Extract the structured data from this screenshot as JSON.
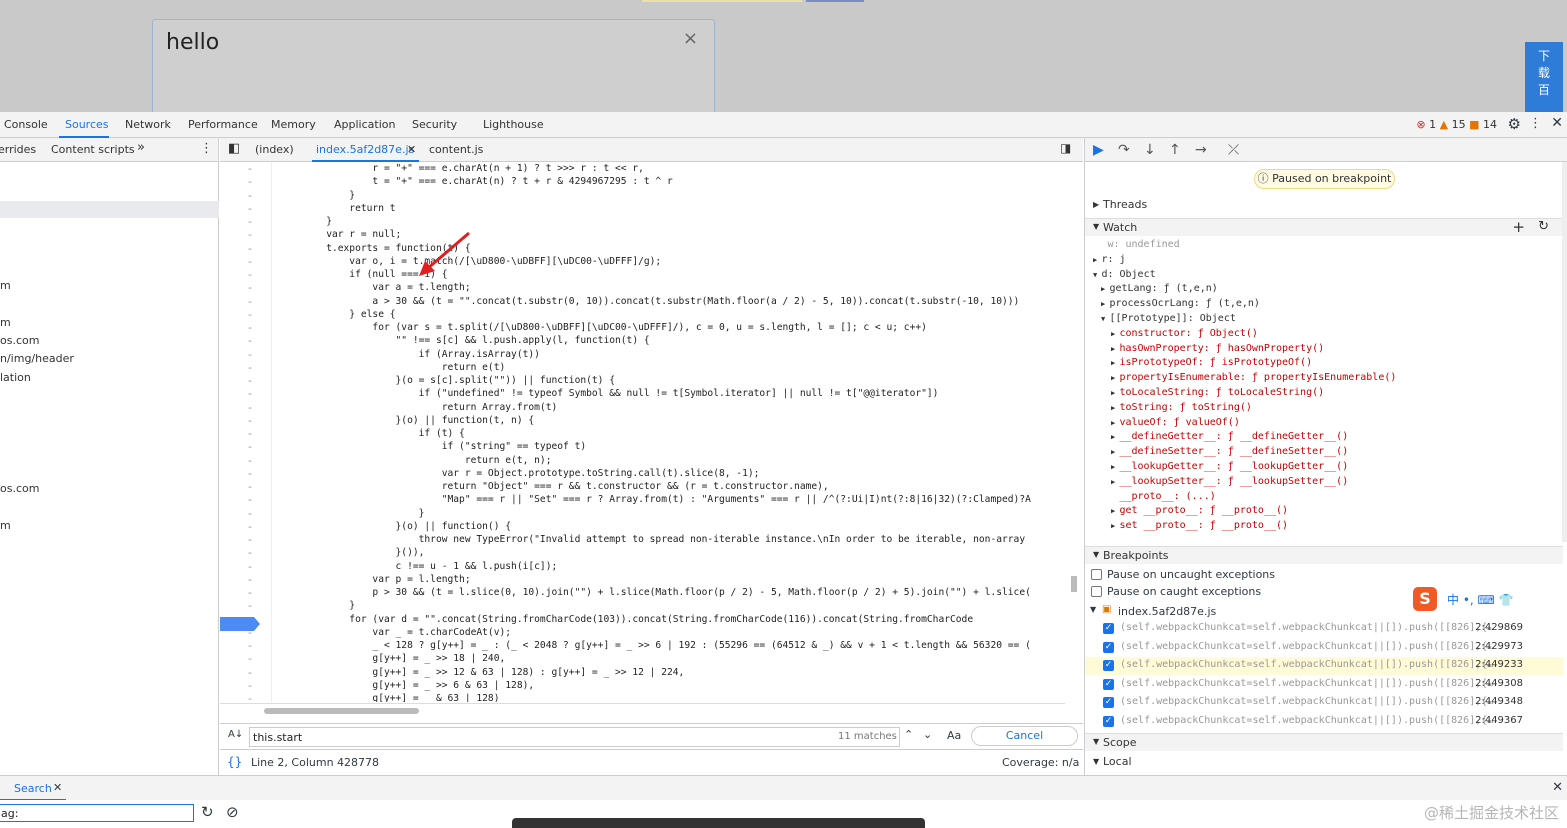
{
  "page": {
    "hello": "hello",
    "close_glyph": "×",
    "side_button": "下\n载\n百"
  },
  "devtools": {
    "tabs": [
      "Console",
      "Sources",
      "Network",
      "Performance",
      "Memory",
      "Application",
      "Security",
      "Lighthouse"
    ],
    "status": {
      "errors": "1",
      "warnings": "15",
      "issues": "14"
    }
  },
  "left": {
    "tabs": [
      "errides",
      "Content scripts"
    ],
    "more": "»",
    "tree": [
      "m",
      "m",
      "os.com",
      "n/img/header",
      "lation",
      "os.com",
      "m"
    ]
  },
  "editor": {
    "tabs": [
      "(index)",
      "index.5af2d87e.js",
      "content.js"
    ],
    "search_value": "this.start",
    "matches": "11 matches",
    "cancel": "Cancel",
    "match_case": "Aa",
    "regex": ".*",
    "position": "Line 2, Column 428778",
    "coverage": "Coverage: n/a",
    "lines": [
      "                r = \"+\" === e.charAt(n + 1) ? t >>> r : t << r,",
      "                t = \"+\" === e.charAt(n) ? t + r & 4294967295 : t ^ r",
      "            }",
      "            return t",
      "        }",
      "        var r = null;",
      "        t.exports = function(t) {",
      "            var o, i = t.match(/[\\uD800-\\uDBFF][\\uDC00-\\uDFFF]/g);",
      "            if (null === i) {",
      "                var a = t.length;",
      "                a > 30 && (t = \"\".concat(t.substr(0, 10)).concat(t.substr(Math.floor(a / 2) - 5, 10)).concat(t.substr(-10, 10)))",
      "            } else {",
      "                for (var s = t.split(/[\\uD800-\\uDBFF][\\uDC00-\\uDFFF]/), c = 0, u = s.length, l = []; c < u; c++)",
      "                    \"\" !== s[c] && l.push.apply(l, function(t) {",
      "                        if (Array.isArray(t))",
      "                            return e(t)",
      "                    }(o = s[c].split(\"\")) || function(t) {",
      "                        if (\"undefined\" != typeof Symbol && null != t[Symbol.iterator] || null != t[\"@@iterator\"])",
      "                            return Array.from(t)",
      "                    }(o) || function(t, n) {",
      "                        if (t) {",
      "                            if (\"string\" == typeof t)",
      "                                return e(t, n);",
      "                            var r = Object.prototype.toString.call(t).slice(8, -1);",
      "                            return \"Object\" === r && t.constructor && (r = t.constructor.name),",
      "                            \"Map\" === r || \"Set\" === r ? Array.from(t) : \"Arguments\" === r || /^(?:Ui|I)nt(?:8|16|32)(?:Clamped)?A",
      "                        }",
      "                    }(o) || function() {",
      "                        throw new TypeError(\"Invalid attempt to spread non-iterable instance.\\nIn order to be iterable, non-array",
      "                    }()),",
      "                    c !== u - 1 && l.push(i[c]);",
      "                var p = l.length;",
      "                p > 30 && (t = l.slice(0, 10).join(\"\") + l.slice(Math.floor(p / 2) - 5, Math.floor(p / 2) + 5).join(\"\") + l.slice(",
      "            }",
      "            for (var d = \"\".concat(String.fromCharCode(103)).concat(String.fromCharCode(116)).concat(String.fromCharCode",
      "                var _ = t.charCodeAt(v);",
      "                _ < 128 ? g[y++] = _ : (_ < 2048 ? g[y++] = _ >> 6 | 192 : (55296 == (64512 & _) && v + 1 < t.length && 56320 == (",
      "                g[y++] = _ >> 18 | 240,",
      "                g[y++] = _ >> 12 & 63 | 128) : g[y++] = _ >> 12 | 224,",
      "                g[y++] = _ >> 6 & 63 | 128),",
      "                g[y++] = _ & 63 | 128)"
    ]
  },
  "right": {
    "paused": "Paused on breakpoint",
    "threads": "Threads",
    "watch": "Watch",
    "watch_items": [
      {
        "text": "w: undefined"
      },
      {
        "text": "r: j"
      },
      {
        "text": "d: Object"
      },
      {
        "text": "getLang: ƒ (t,e,n)"
      },
      {
        "text": "processOcrLang: ƒ (t,e,n)"
      },
      {
        "text": "[[Prototype]]: Object"
      },
      {
        "text": "constructor: ƒ Object()"
      },
      {
        "text": "hasOwnProperty: ƒ hasOwnProperty()"
      },
      {
        "text": "isPrototypeOf: ƒ isPrototypeOf()"
      },
      {
        "text": "propertyIsEnumerable: ƒ propertyIsEnumerable()"
      },
      {
        "text": "toLocaleString: ƒ toLocaleString()"
      },
      {
        "text": "toString: ƒ toString()"
      },
      {
        "text": "valueOf: ƒ valueOf()"
      },
      {
        "text": "__defineGetter__: ƒ __defineGetter__()"
      },
      {
        "text": "__defineSetter__: ƒ __defineSetter__()"
      },
      {
        "text": "__lookupGetter__: ƒ __lookupGetter__()"
      },
      {
        "text": "__lookupSetter__: ƒ __lookupSetter__()"
      },
      {
        "text": "__proto__: (...)"
      },
      {
        "text": "get __proto__: ƒ __proto__()"
      },
      {
        "text": "set __proto__: ƒ __proto__()"
      }
    ],
    "breakpoints": "Breakpoints",
    "pause_uncaught": "Pause on uncaught exceptions",
    "pause_caught": "Pause on caught exceptions",
    "bp_file": "index.5af2d87e.js",
    "bp_rows": [
      {
        "code": "(self.webpackChunkcat=self.webpackChunkcat||[]).push([[826],{…",
        "line": "2:429869"
      },
      {
        "code": "(self.webpackChunkcat=self.webpackChunkcat||[]).push([[826],{…",
        "line": "2:429973"
      },
      {
        "code": "(self.webpackChunkcat=self.webpackChunkcat||[]).push([[826],{…",
        "line": "2:449233"
      },
      {
        "code": "(self.webpackChunkcat=self.webpackChunkcat||[]).push([[826],{…",
        "line": "2:449308"
      },
      {
        "code": "(self.webpackChunkcat=self.webpackChunkcat||[]).push([[826],{…",
        "line": "2:449348"
      },
      {
        "code": "(self.webpackChunkcat=self.webpackChunkcat||[]).push([[826],{…",
        "line": "2:449367"
      }
    ],
    "scope": "Scope",
    "local": "Local"
  },
  "drawer": {
    "tab": "Search",
    "input": "ag:"
  },
  "watermark": "@稀土掘金技术社区",
  "ime": "中 •, ⌨ 👕"
}
